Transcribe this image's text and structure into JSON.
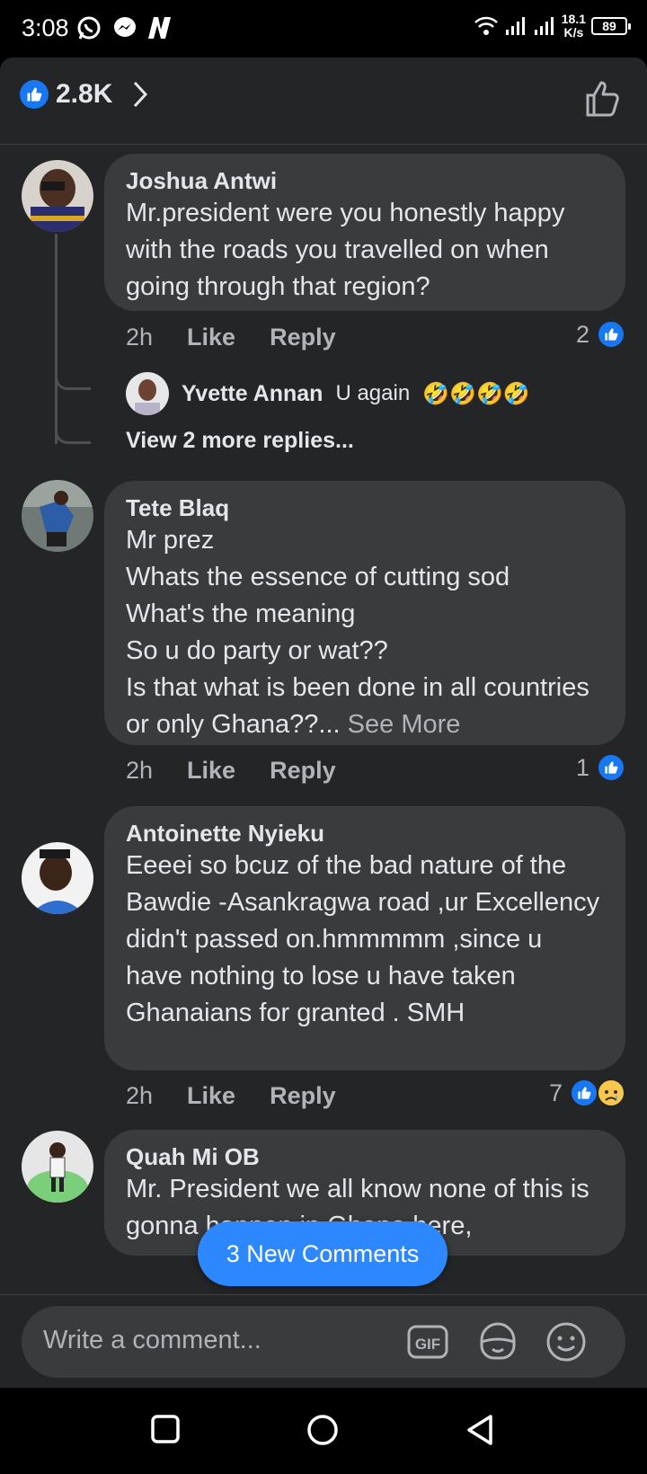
{
  "status_bar": {
    "time": "3:08",
    "speed_value": "18.1",
    "speed_unit": "K/s",
    "battery": "89"
  },
  "header": {
    "likes_count": "2.8K"
  },
  "comments": [
    {
      "author": "Joshua Antwi",
      "text": "Mr.president were you honestly happy with the roads you travelled on when going through that region?",
      "time": "2h",
      "like_label": "Like",
      "reply_label": "Reply",
      "reaction_count": "2",
      "reply": {
        "author": "Yvette Annan",
        "text": "U again",
        "emoji": "🤣🤣🤣🤣"
      },
      "view_more": "View 2 more replies..."
    },
    {
      "author": "Tete Blaq",
      "text": "Mr prez\nWhats the essence of cutting sod\nWhat's the meaning\nSo u do party or wat??\nIs that what is been done in all countries or only Ghana??...",
      "see_more": " See More",
      "time": "2h",
      "like_label": "Like",
      "reply_label": "Reply",
      "reaction_count": "1"
    },
    {
      "author": "Antoinette Nyieku",
      "text": "Eeeei so bcuz of the bad nature of the Bawdie -Asankragwa road ,ur Excellency didn't passed on.hmmmmm ,since u have nothing to lose u have taken Ghanaians for granted . SMH",
      "time": "2h",
      "like_label": "Like",
      "reply_label": "Reply",
      "reaction_count": "7"
    },
    {
      "author": "Quah Mi OB",
      "text": "Mr. President we all know none of this is gonna happen in Ghana here,"
    }
  ],
  "new_comments_pill": "3 New Comments",
  "composer": {
    "placeholder": "Write a comment..."
  }
}
